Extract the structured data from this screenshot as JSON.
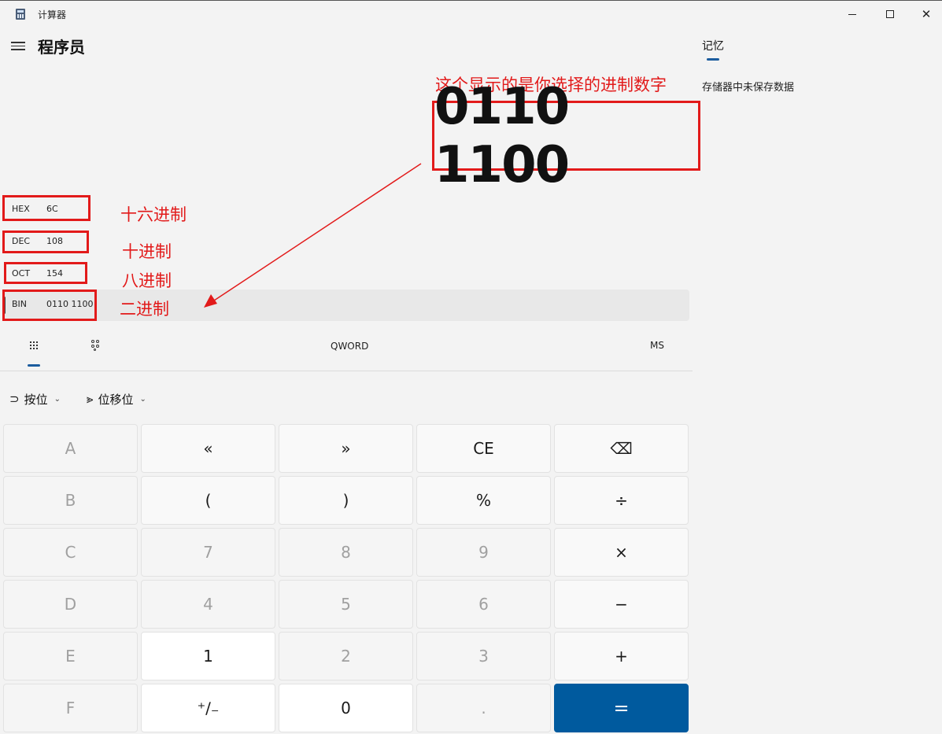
{
  "window": {
    "title": "计算器",
    "icon": "calculator-icon",
    "controls": {
      "minimize": "minimize-icon",
      "maximize": "maximize-icon",
      "close": "✕"
    }
  },
  "header": {
    "menu_icon": "hamburger-icon",
    "mode": "程序员"
  },
  "display": {
    "value": "0110 1100"
  },
  "radix": [
    {
      "label": "HEX",
      "value": "6C",
      "active": false
    },
    {
      "label": "DEC",
      "value": "108",
      "active": false
    },
    {
      "label": "OCT",
      "value": "154",
      "active": false
    },
    {
      "label": "BIN",
      "value": "0110 1100",
      "active": true
    }
  ],
  "keypad_tabs": {
    "full_keypad_icon": "keypad-grid-icon",
    "bit_toggle_icon": "bit-toggle-icon",
    "word_size": "QWORD",
    "memory_store": "MS"
  },
  "menus": {
    "bitwise": {
      "icon": "logic-gate-icon",
      "label": "按位"
    },
    "bitshift": {
      "icon": "bit-shift-icon",
      "label": "位移位"
    }
  },
  "keys": [
    [
      "A",
      "«",
      "»",
      "CE",
      "⌫"
    ],
    [
      "B",
      "(",
      ")",
      "%",
      "÷"
    ],
    [
      "C",
      "7",
      "8",
      "9",
      "×"
    ],
    [
      "D",
      "4",
      "5",
      "6",
      "−"
    ],
    [
      "E",
      "1",
      "2",
      "3",
      "+"
    ],
    [
      "F",
      "⁺∕₋",
      "0",
      ".",
      "="
    ]
  ],
  "memory": {
    "tab": "记忆",
    "empty_message": "存储器中未保存数据"
  },
  "annotations": {
    "display_note": "这个显示的是你选择的进制数字",
    "hex_note": "十六进制",
    "dec_note": "十进制",
    "oct_note": "八进制",
    "bin_note": "二进制"
  },
  "colors": {
    "accent": "#005a9e",
    "annotation": "#e21a1a",
    "background": "#f3f3f3"
  }
}
